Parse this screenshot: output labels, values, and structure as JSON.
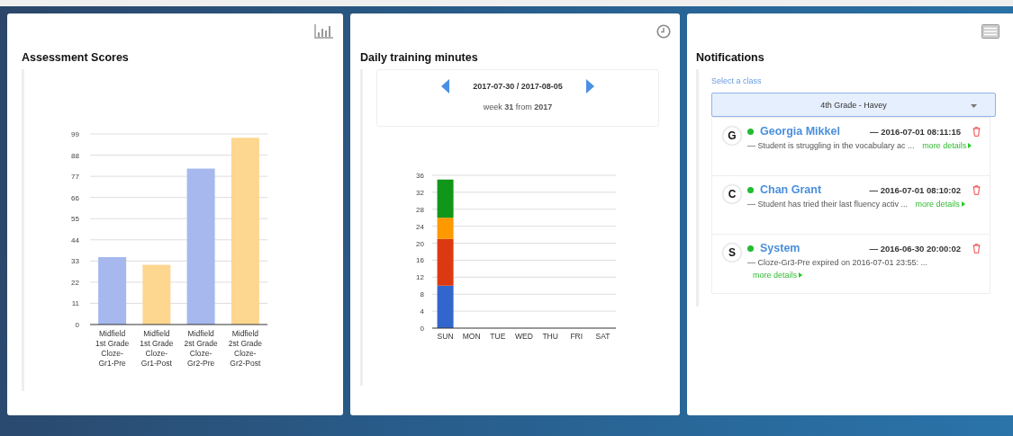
{
  "assessment": {
    "title": "Assessment Scores",
    "chart_data": {
      "type": "bar",
      "categories": [
        "Midfield 1st Grade Cloze-Gr1-Pre",
        "Midfield 1st Grade Cloze-Gr1-Post",
        "Midfield 2st Grade Cloze-Gr2-Pre",
        "Midfield 2st Grade Cloze-Gr2-Post"
      ],
      "series": [
        {
          "color": "#a6b8ee",
          "values": [
            35,
            null,
            81,
            null
          ]
        },
        {
          "color": "#fdd68f",
          "values": [
            null,
            31,
            null,
            97
          ]
        }
      ],
      "ylim": [
        0,
        99
      ],
      "grid": true,
      "yticks": [
        0,
        11,
        22,
        33,
        44,
        55,
        66,
        77,
        88,
        99
      ]
    }
  },
  "training": {
    "title": "Daily training minutes",
    "range": "2017-07-30 / 2017-08-05",
    "week": "week **31** from **2017**",
    "chart_data": {
      "type": "bar",
      "stacked": true,
      "categories": [
        "SUN",
        "MON",
        "TUE",
        "WED",
        "THU",
        "FRI",
        "SAT"
      ],
      "series": [
        {
          "color": "#3366cc",
          "values": [
            10,
            0,
            0,
            0,
            0,
            0,
            0
          ]
        },
        {
          "color": "#dc3912",
          "values": [
            11,
            0,
            0,
            0,
            0,
            0,
            0
          ]
        },
        {
          "color": "#ff9900",
          "values": [
            5,
            0,
            0,
            0,
            0,
            0,
            0
          ]
        },
        {
          "color": "#109618",
          "values": [
            9,
            0,
            0,
            0,
            0,
            0,
            0
          ]
        }
      ],
      "ylim": [
        0,
        36
      ],
      "grid": true,
      "yticks": [
        0,
        4,
        8,
        12,
        16,
        20,
        24,
        28,
        32,
        36
      ]
    }
  },
  "notifications": {
    "title": "Notifications",
    "select_label": "Select a class",
    "selected_class": "4th Grade - Havey",
    "items": [
      {
        "initial": "G",
        "name": "Georgia Mikkel",
        "time": "— 2016-07-01 08:11:15",
        "message": "— Student is struggling in the vocabulary ac ...",
        "link": "more details"
      },
      {
        "initial": "C",
        "name": "Chan Grant",
        "time": "— 2016-07-01 08:10:02",
        "message": "— Student has tried their last fluency activ ...",
        "link": "more details"
      },
      {
        "initial": "S",
        "name": "System",
        "time": "— 2016-06-30 20:00:02",
        "message": "— Cloze-Gr3-Pre expired on 2016-07-01 23:55: ...",
        "link": "more details"
      }
    ]
  }
}
